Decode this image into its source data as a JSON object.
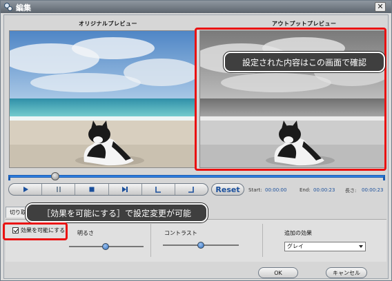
{
  "window": {
    "title": "編集",
    "close_label": "✕"
  },
  "previews": {
    "original_label": "オリジナルプレビュー",
    "output_label": "アウトプットプレビュー"
  },
  "transport": {
    "reset_label": "Reset"
  },
  "times": {
    "start_label": "Start:",
    "start_value": "00:00:00",
    "end_label": "End:",
    "end_value": "00:00:23",
    "length_label": "長さ:",
    "length_value": "00:00:23"
  },
  "tabs": {
    "crop_label": "切り取り"
  },
  "effects": {
    "enable_label": "効果を可能にする",
    "enabled": true,
    "brightness_label": "明るさ",
    "contrast_label": "コントラスト",
    "extra_label": "追加の効果",
    "extra_selected": "グレイ"
  },
  "buttons": {
    "ok_label": "OK",
    "cancel_label": "キャンセル"
  },
  "annotations": {
    "output_callout": "設定された内容はこの画面で確認",
    "enable_callout": "［効果を可能にする］で設定変更が可能",
    "highlight_color": "#ea1111"
  }
}
